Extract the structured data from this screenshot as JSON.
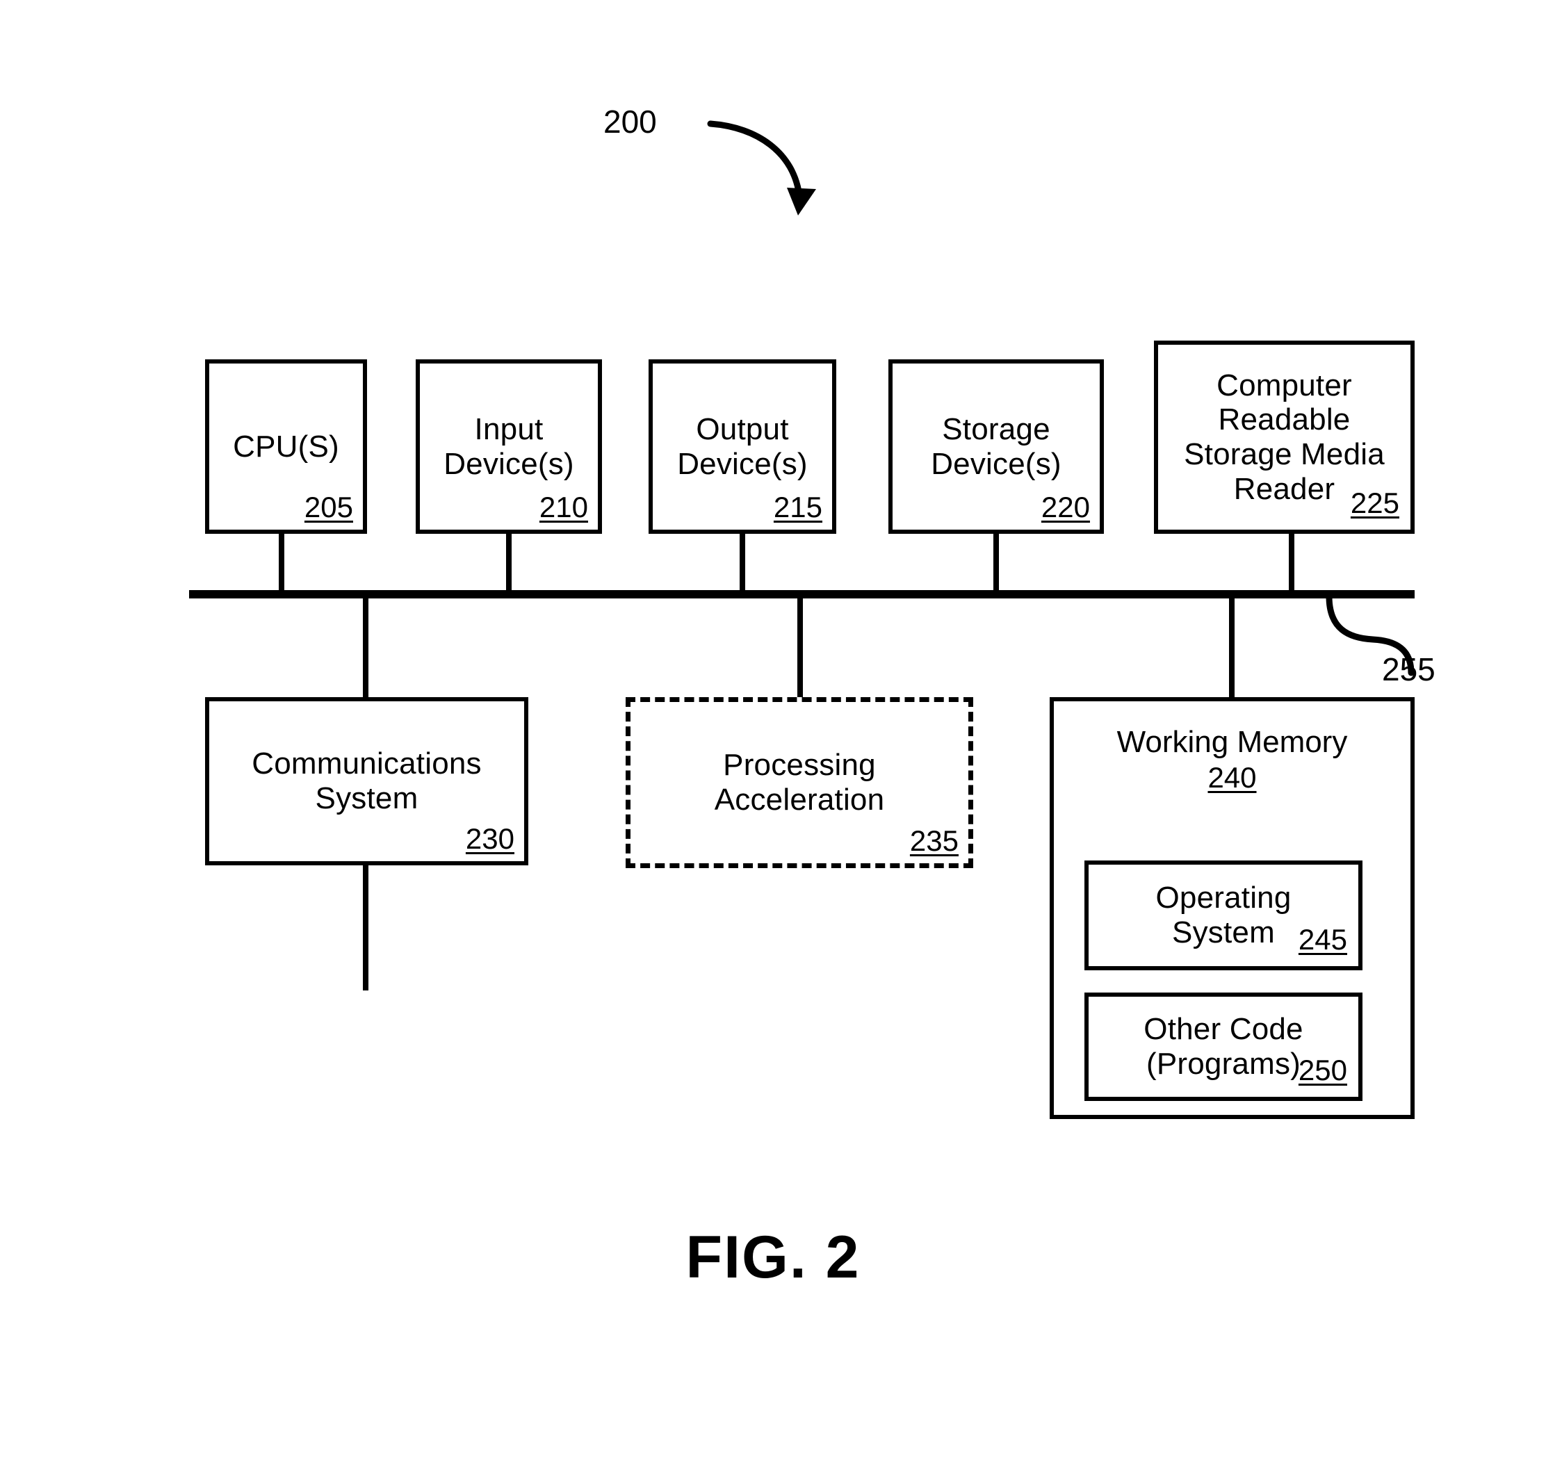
{
  "figure": {
    "caption": "FIG. 2",
    "system_ref": "200",
    "bus_ref": "255"
  },
  "top_row": [
    {
      "title": "CPU(S)",
      "ref": "205",
      "border": "solid"
    },
    {
      "title": "Input\nDevice(s)",
      "ref": "210",
      "border": "solid"
    },
    {
      "title": "Output\nDevice(s)",
      "ref": "215",
      "border": "solid"
    },
    {
      "title": "Storage\nDevice(s)",
      "ref": "220",
      "border": "solid"
    },
    {
      "title": "Computer\nReadable\nStorage Media\nReader",
      "ref": "225",
      "border": "solid"
    }
  ],
  "bottom_row": [
    {
      "title": "Communications\nSystem",
      "ref": "230",
      "border": "solid"
    },
    {
      "title": "Processing\nAcceleration",
      "ref": "235",
      "border": "dashed"
    },
    {
      "title": "Working\nMemory",
      "ref": "240",
      "border": "solid"
    }
  ],
  "working_memory_children": [
    {
      "title": "Operating\nSystem",
      "ref": "245"
    },
    {
      "title": "Other Code\n(Programs)",
      "ref": "250"
    }
  ],
  "colors": {
    "stroke": "#000000",
    "background": "#ffffff"
  }
}
